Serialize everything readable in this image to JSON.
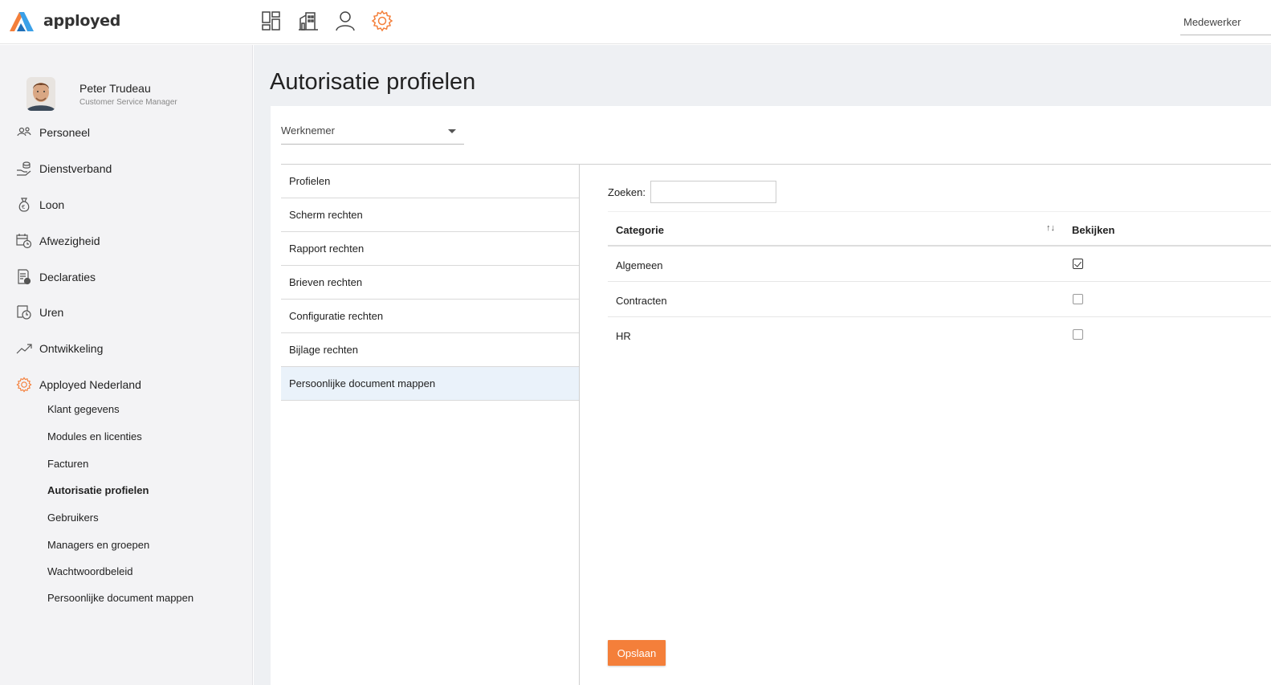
{
  "app": {
    "name": "apployed",
    "brand_color": "#f47f3a",
    "role": "Medewerker"
  },
  "topnav": [
    {
      "icon": "dashboard-icon"
    },
    {
      "icon": "building-icon"
    },
    {
      "icon": "user-icon"
    },
    {
      "icon": "gear-icon",
      "active": true
    }
  ],
  "profile": {
    "name": "Peter Trudeau",
    "role": "Customer Service Manager"
  },
  "sidebar": {
    "items": [
      {
        "label": "Personeel",
        "icon": "people-icon"
      },
      {
        "label": "Dienstverband",
        "icon": "contract-icon"
      },
      {
        "label": "Loon",
        "icon": "money-bag-icon"
      },
      {
        "label": "Afwezigheid",
        "icon": "calendar-clock-icon"
      },
      {
        "label": "Declaraties",
        "icon": "receipt-icon"
      },
      {
        "label": "Uren",
        "icon": "hours-icon"
      },
      {
        "label": "Ontwikkeling",
        "icon": "trend-icon"
      },
      {
        "label": "Apployed Nederland",
        "icon": "gear-icon"
      }
    ],
    "subitems": [
      {
        "label": "Klant gegevens"
      },
      {
        "label": "Modules en licenties"
      },
      {
        "label": "Facturen"
      },
      {
        "label": "Autorisatie profielen",
        "active": true
      },
      {
        "label": "Gebruikers"
      },
      {
        "label": "Managers en groepen"
      },
      {
        "label": "Wachtwoordbeleid"
      },
      {
        "label": "Persoonlijke document mappen"
      }
    ]
  },
  "page": {
    "title": "Autorisatie profielen",
    "profile_select": "Werknemer",
    "menu": [
      {
        "label": "Profielen"
      },
      {
        "label": "Scherm rechten"
      },
      {
        "label": "Rapport rechten"
      },
      {
        "label": "Brieven rechten"
      },
      {
        "label": "Configuratie rechten"
      },
      {
        "label": "Bijlage rechten"
      },
      {
        "label": "Persoonlijke document mappen",
        "active": true
      }
    ],
    "search_label": "Zoeken:",
    "search_value": "",
    "table": {
      "columns": [
        "Categorie",
        "Bekijken"
      ],
      "sort_glyph": "↑↓",
      "rows": [
        {
          "category": "Algemeen",
          "view": true
        },
        {
          "category": "Contracten",
          "view": false
        },
        {
          "category": "HR",
          "view": false
        }
      ]
    },
    "save_label": "Opslaan"
  }
}
